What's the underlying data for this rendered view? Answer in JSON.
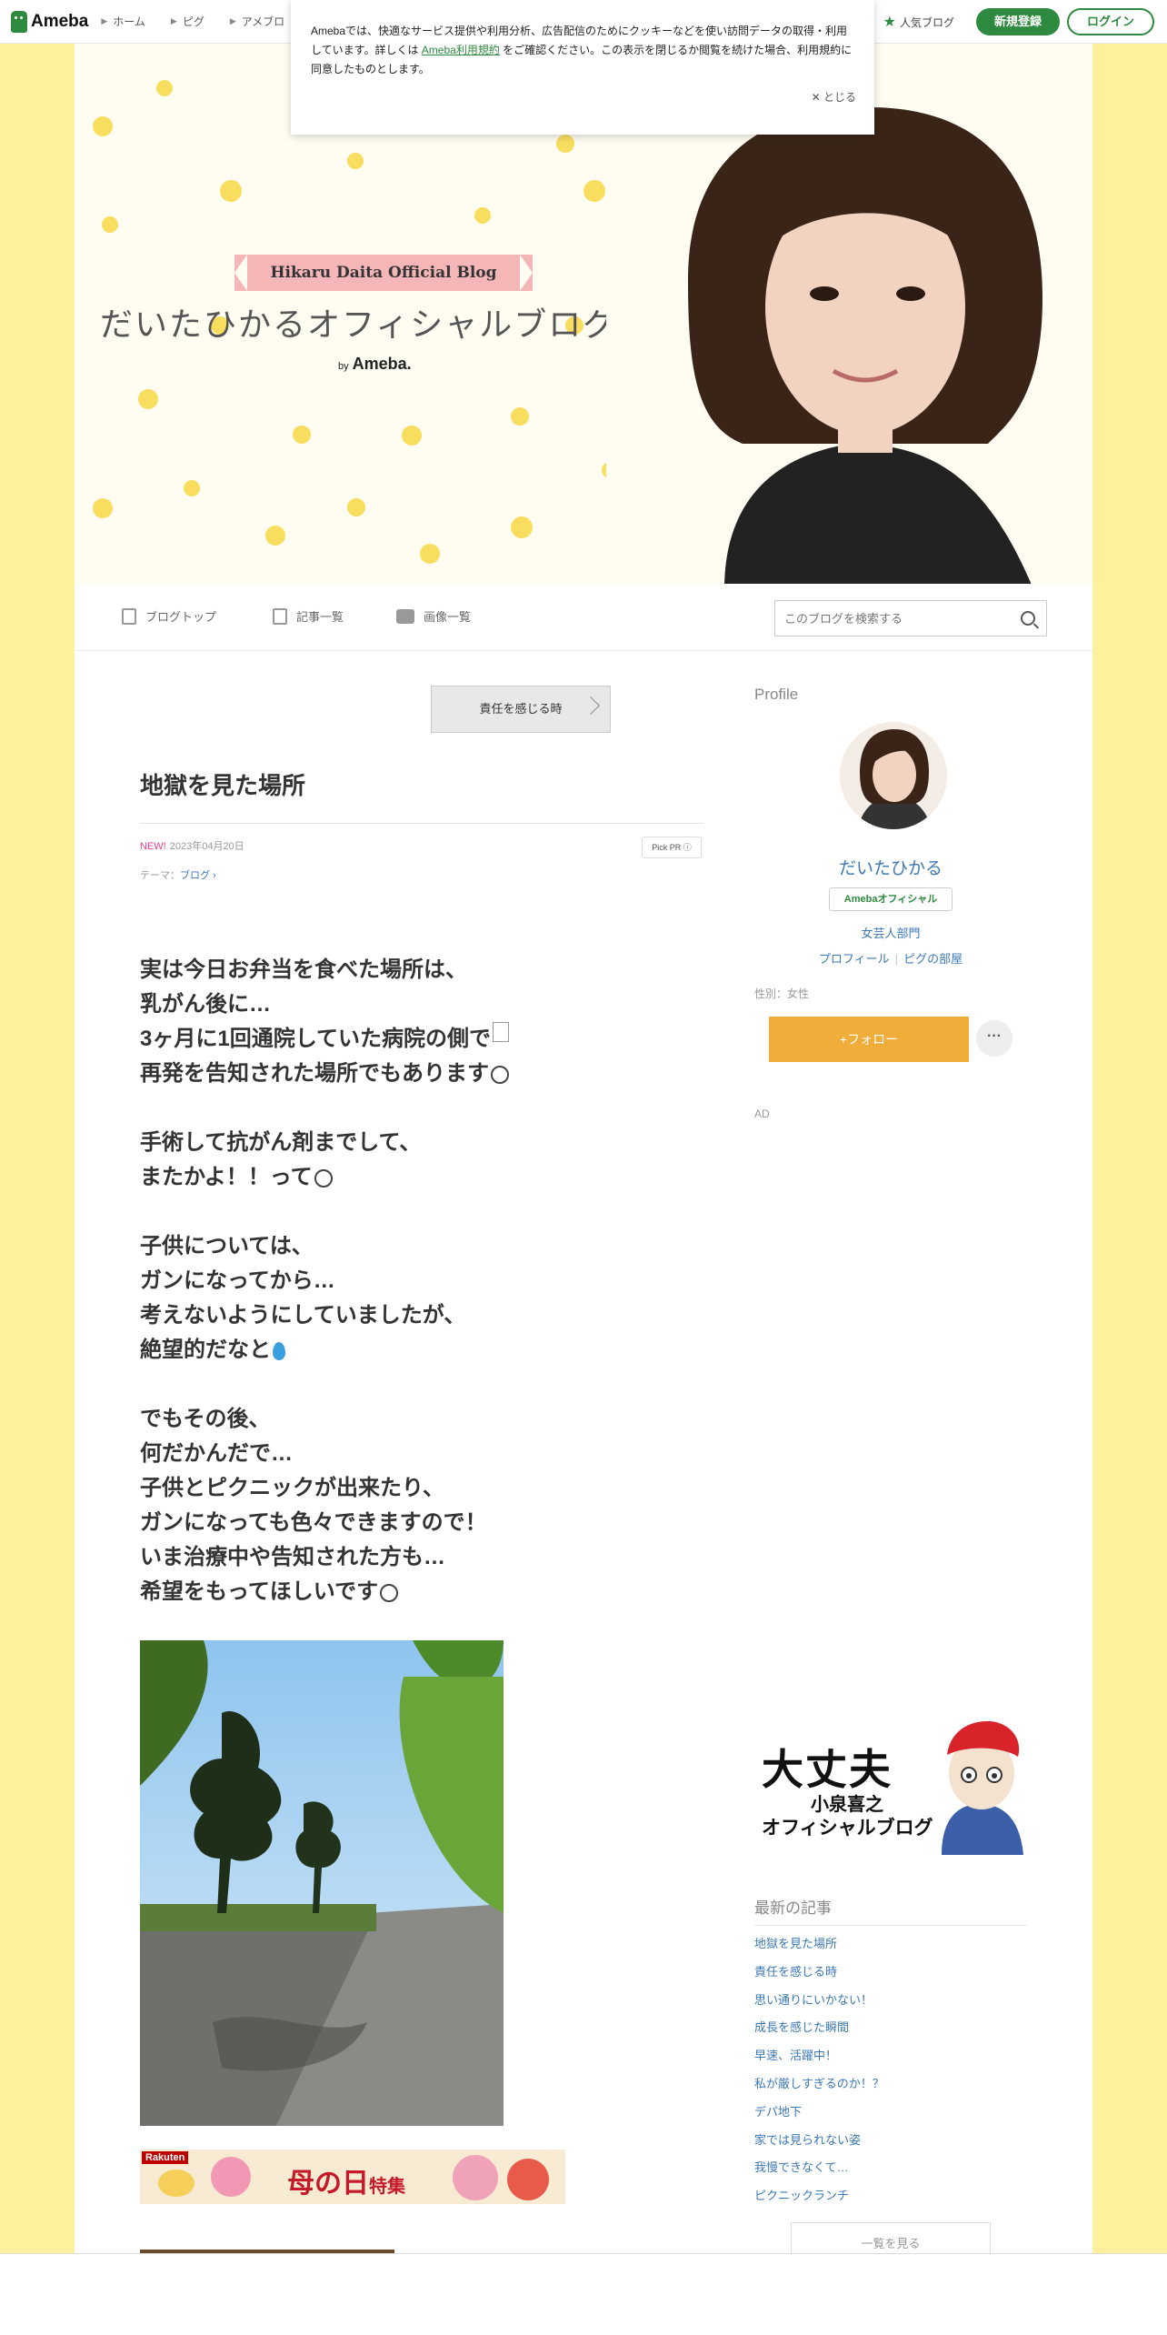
{
  "topbar": {
    "logo": "Ameba",
    "nav": [
      "ホーム",
      "ピグ",
      "アメブロ"
    ],
    "popular": "人気ブログ",
    "register": "新規登録",
    "login": "ログイン"
  },
  "cookie": {
    "text_before": "Amebaでは、快適なサービス提供や利用分析、広告配信のためにクッキーなどを使い訪問データの取得・利用しています。詳しくは",
    "link": "Ameba利用規約",
    "text_after": "をご確認ください。この表示を閉じるか閲覧を続けた場合、利用規約に同意したものとします。",
    "close": "✕ とじる"
  },
  "header": {
    "ribbon": "Hikaru Daita Official Blog",
    "title": "だいたひかるオフィシャルブログ",
    "by": "by",
    "brand": "Ameba."
  },
  "blognav": {
    "items": [
      "ブログトップ",
      "記事一覧",
      "画像一覧"
    ],
    "search_placeholder": "このブログを検索する"
  },
  "post": {
    "prev": "責任を感じる時",
    "title": "地獄を見た場所",
    "new": "NEW!",
    "date": "2023年04月20日",
    "pickpr": "Pick PR ⓘ",
    "theme_label": "テーマ：",
    "theme": "ブログ",
    "lines": [
      "実は今日お弁当を食べた場所は、",
      "乳がん後に…",
      "3ヶ月に1回通院していた病院の側で",
      "再発を告知された場所でもあります",
      "",
      "手術して抗がん剤までして、",
      "またかよ！！って",
      "",
      "子供については、",
      "ガンになってから…",
      "考えないようにしていましたが、",
      "絶望的だなと",
      "",
      "でもその後、",
      "何だかんだで…",
      "子供とピクニックが出来たり、",
      "ガンになっても色々できますので！",
      "いま治療中や告知された方も…",
      "希望をもってほしいです"
    ],
    "banner_brand": "Rakuten",
    "banner_text": "母の日",
    "banner_sub": "特集"
  },
  "sidebar": {
    "profile_head": "Profile",
    "name": "だいたひかる",
    "badge": "Amebaオフィシャル",
    "category": "女芸人部門",
    "links": [
      "プロフィール",
      "ピグの部屋"
    ],
    "gender": "性別：女性",
    "follow": "+フォロー",
    "more": "···",
    "ad": "AD",
    "promo_big": "大丈夫",
    "promo_name": "小泉喜之",
    "promo_sub": "オフィシャルブログ",
    "recent_head": "最新の記事",
    "recent": [
      "地獄を見た場所",
      "責任を感じる時",
      "思い通りにいかない！",
      "成長を感じた瞬間",
      "早速、活躍中！",
      "私が厳しすぎるのか！？",
      "デパ地下",
      "家では見られない姿",
      "我慢できなくて…",
      "ピクニックランチ"
    ],
    "see_all": "一覧を見る"
  },
  "colors": {
    "accent_green": "#2d8a3e",
    "page_yellow": "#fdf19d",
    "link_blue": "#3c78b4",
    "follow_orange": "#f0ad3a"
  }
}
